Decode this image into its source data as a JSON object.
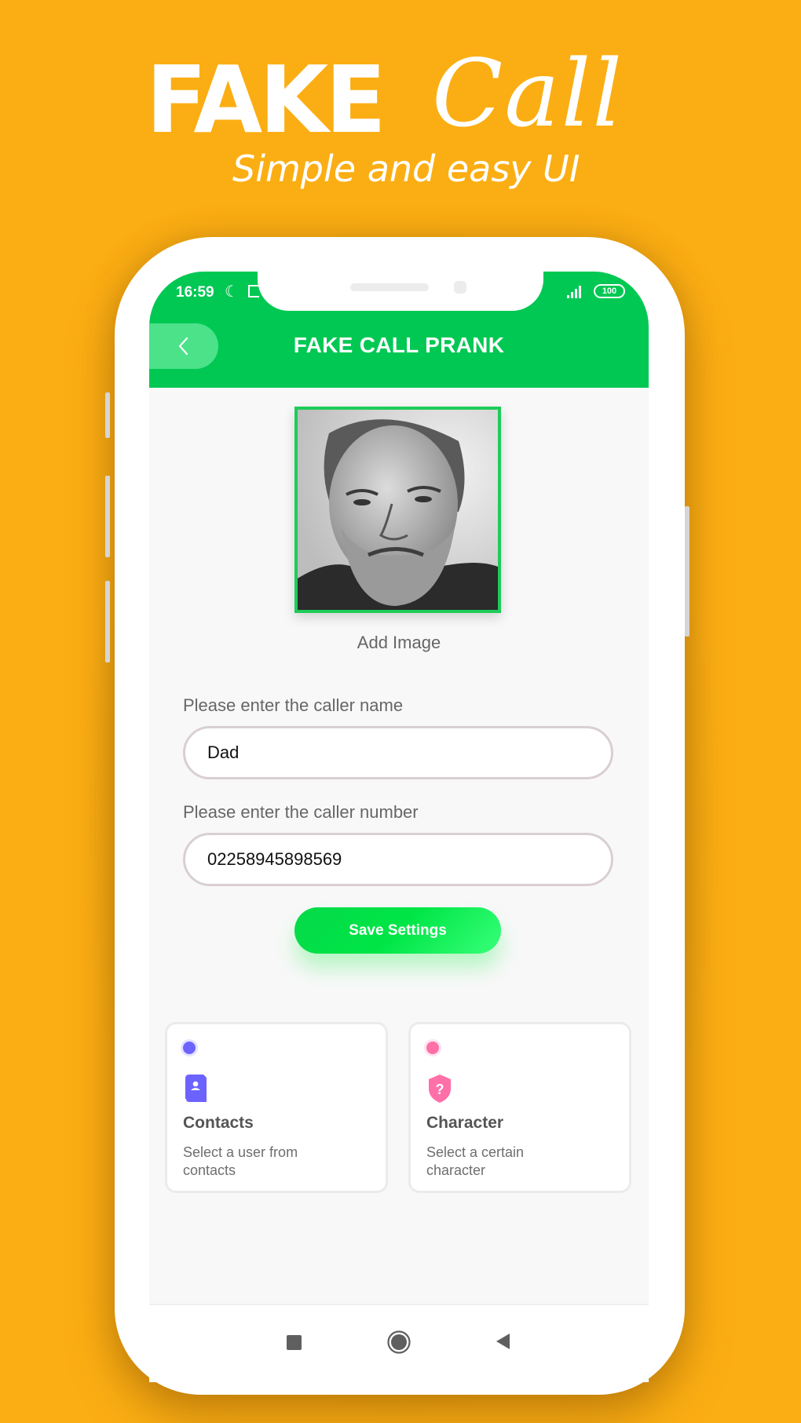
{
  "promo": {
    "title_word1": "FAKE",
    "title_word2": "Call",
    "subtitle": "Simple and easy UI",
    "background_color": "#fbae13"
  },
  "status_bar": {
    "time": "16:59",
    "icons": [
      "moon-icon",
      "notification-icon"
    ],
    "signal": "signal-icon",
    "battery": "100"
  },
  "app_bar": {
    "title": "FAKE CALL PRANK",
    "back_icon": "chevron-left-icon",
    "color": "#00c853"
  },
  "profile": {
    "image_alt": "Caller photo (grayscale portrait of a bearded man)",
    "add_image_label": "Add Image",
    "border_color": "#1ecb5a"
  },
  "form": {
    "name_label": "Please enter the caller name",
    "name_value": "Dad",
    "number_label": "Please enter the caller number",
    "number_value": "02258945898569",
    "save_label": "Save Settings"
  },
  "cards": [
    {
      "title": "Contacts",
      "description": "Select a user from contacts",
      "icon": "contact-book-icon",
      "color": "#6c63ff"
    },
    {
      "title": "Character",
      "description": "Select a certain character",
      "icon": "shield-question-icon",
      "color": "#ff6fa8"
    }
  ],
  "nav_bar": {
    "items": [
      "recents-square-icon",
      "home-circle-icon",
      "back-triangle-icon"
    ]
  }
}
